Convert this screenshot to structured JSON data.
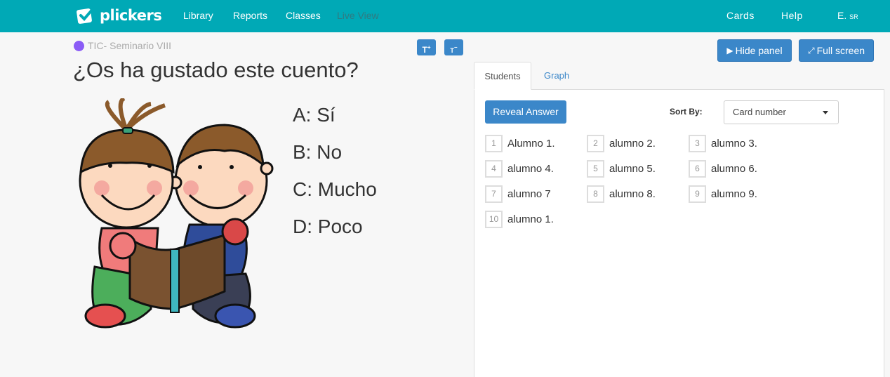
{
  "nav": {
    "logo": "plickers",
    "library": "Library",
    "reports": "Reports",
    "classes": "Classes",
    "live_view": "Live View",
    "cards": "Cards",
    "help": "Help",
    "user": "E.",
    "user_suffix": "SR"
  },
  "class": {
    "name": "TIC- Seminario VIII",
    "color": "#8b5cf6"
  },
  "text_controls": {
    "increase": "T",
    "increase_sup": "+",
    "decrease": "T",
    "decrease_sup": "−"
  },
  "question": {
    "text": "¿Os ha gustado este cuento?",
    "answers": [
      "A: Sí",
      "B: No",
      "C: Mucho",
      "D: Poco"
    ]
  },
  "panel": {
    "hide_label": "Hide panel",
    "fullscreen_label": "Full screen",
    "tabs": [
      "Students",
      "Graph"
    ],
    "reveal_label": "Reveal Answer",
    "sort_label": "Sort By:",
    "sort_value": "Card number"
  },
  "students": [
    {
      "num": "1",
      "name": "Alumno 1."
    },
    {
      "num": "2",
      "name": "alumno 2."
    },
    {
      "num": "3",
      "name": "alumno 3."
    },
    {
      "num": "4",
      "name": "alumno 4."
    },
    {
      "num": "5",
      "name": "alumno 5."
    },
    {
      "num": "6",
      "name": "alumno 6."
    },
    {
      "num": "7",
      "name": "alumno 7"
    },
    {
      "num": "8",
      "name": "alumno 8."
    },
    {
      "num": "9",
      "name": "alumno 9."
    },
    {
      "num": "10",
      "name": "alumno 1."
    }
  ],
  "colors": {
    "topbar": "#00a9b6",
    "accent": "#3b87c9"
  }
}
